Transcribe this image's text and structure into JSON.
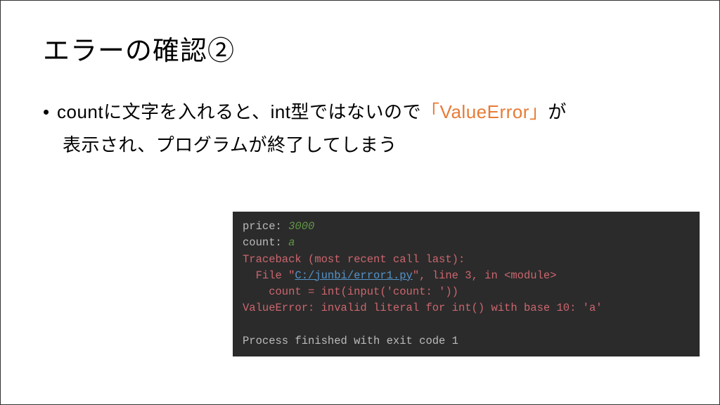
{
  "title": "エラーの確認②",
  "bullet": {
    "prefix": "• ",
    "text1": "countに文字を入れると、int型ではないので",
    "highlight_open": "「",
    "highlight_word": "ValueError",
    "highlight_close": "」",
    "text2": "が",
    "line2": "表示され、プログラムが終了してしまう"
  },
  "code": {
    "l1a": "price: ",
    "l1b": "3000",
    "l2a": "count: ",
    "l2b": "a",
    "l3": "Traceback (most recent call last):",
    "l4a": "  File \"",
    "l4b": "C:/junbi/error1.py",
    "l4c": "\", line 3, in <module>",
    "l5": "    count = int(input('count: '))",
    "l6": "ValueError: invalid literal for int() with base 10: 'a'",
    "l7": " ",
    "l8": "Process finished with exit code 1"
  }
}
